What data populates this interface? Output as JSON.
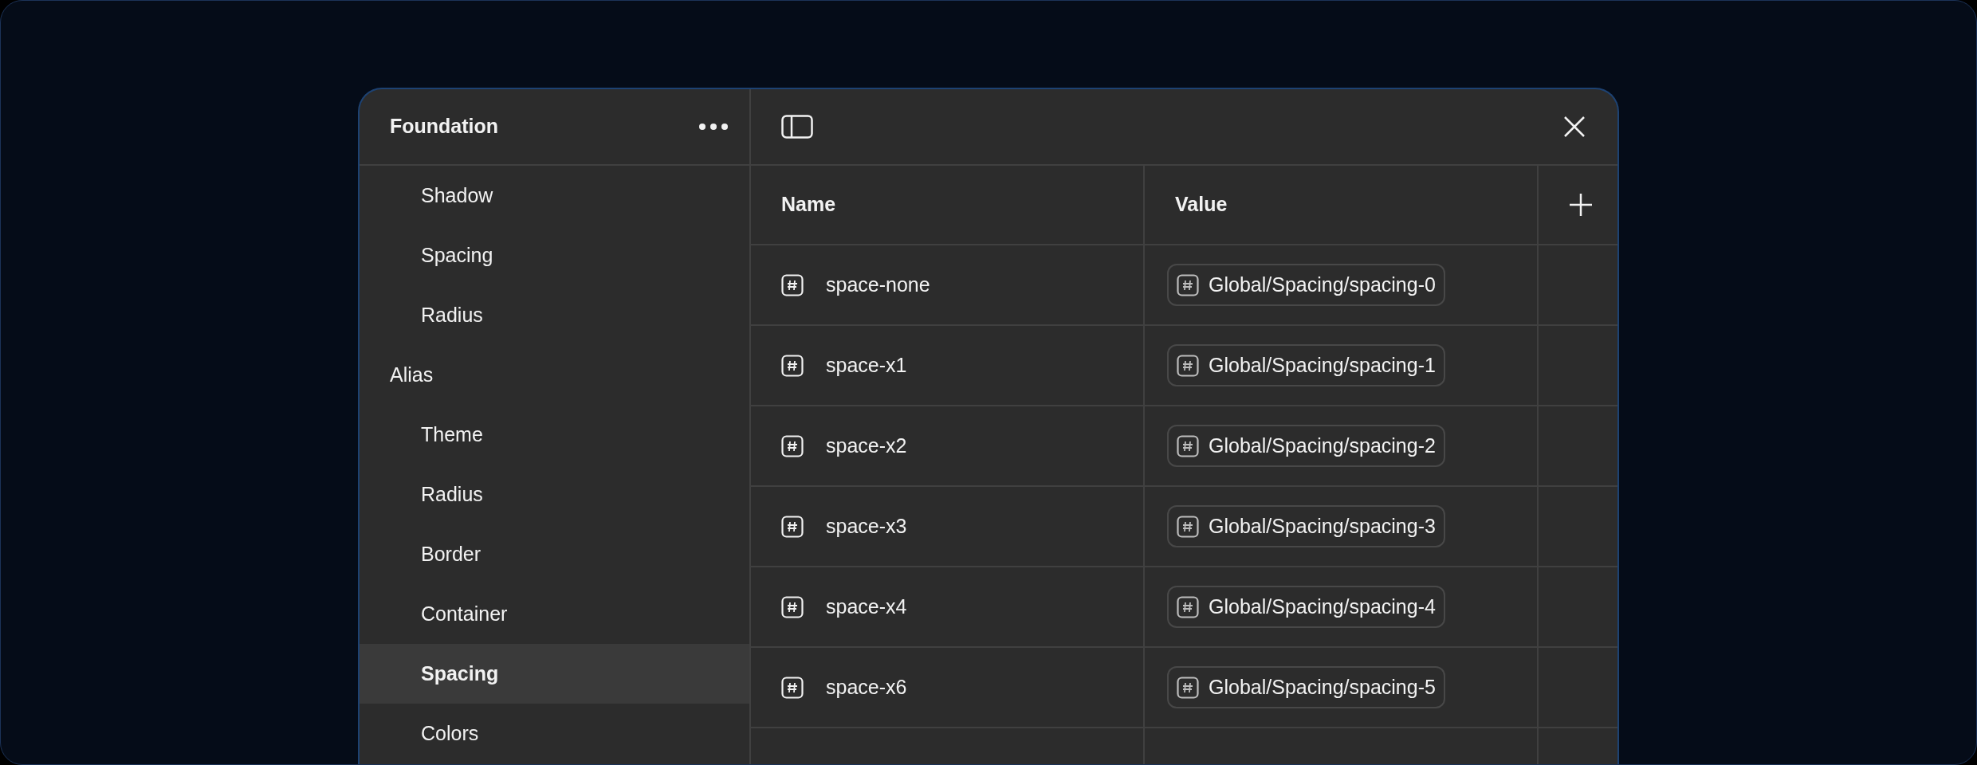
{
  "sidebar": {
    "title": "Foundation",
    "items": [
      {
        "children": [
          {
            "label": "Shadow",
            "selected": false
          },
          {
            "label": "Spacing",
            "selected": false
          },
          {
            "label": "Radius",
            "selected": false
          }
        ]
      },
      {
        "label": "Alias",
        "selected": false,
        "children": [
          {
            "label": "Theme",
            "selected": false
          },
          {
            "label": "Radius",
            "selected": false
          },
          {
            "label": "Border",
            "selected": false
          },
          {
            "label": "Container",
            "selected": false
          },
          {
            "label": "Spacing",
            "selected": true
          },
          {
            "label": "Colors",
            "selected": false
          }
        ]
      }
    ]
  },
  "table": {
    "columns": [
      "Name",
      "Value"
    ],
    "rows": [
      {
        "name": "space-none",
        "value": "Global/Spacing/spacing-0"
      },
      {
        "name": "space-x1",
        "value": "Global/Spacing/spacing-1"
      },
      {
        "name": "space-x2",
        "value": "Global/Spacing/spacing-2"
      },
      {
        "name": "space-x3",
        "value": "Global/Spacing/spacing-3"
      },
      {
        "name": "space-x4",
        "value": "Global/Spacing/spacing-4"
      },
      {
        "name": "space-x6",
        "value": "Global/Spacing/spacing-5"
      }
    ]
  }
}
